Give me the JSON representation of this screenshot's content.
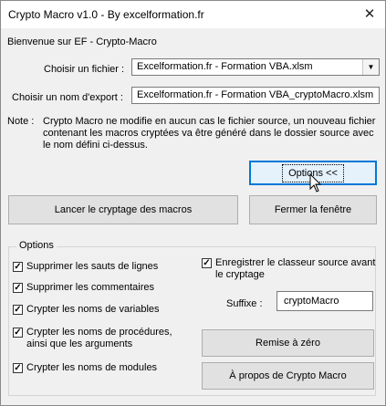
{
  "window": {
    "title": "Crypto Macro v1.0 - By excelformation.fr",
    "close_glyph": "✕"
  },
  "welcome": "Bienvenue sur EF - Crypto-Macro",
  "file": {
    "label": "Choisir un fichier :",
    "value": "Excelformation.fr - Formation VBA.xlsm",
    "arrow": "▼"
  },
  "export": {
    "label": "Choisir un nom d'export :",
    "value": "Excelformation.fr - Formation VBA_cryptoMacro.xlsm"
  },
  "note": {
    "label": "Note :",
    "lines": [
      "Crypto Macro ne modifie en aucun cas le fichier source, un nouveau fichier",
      "contenant les macros cryptées va être généré dans le dossier source avec",
      "le nom défini ci-dessus."
    ]
  },
  "buttons": {
    "options": "Options <<",
    "run": "Lancer le cryptage des macros",
    "close": "Fermer la fenêtre",
    "reset": "Remise à zéro",
    "about": "À propos de Crypto Macro"
  },
  "options": {
    "title": "Options",
    "checks": [
      {
        "label": "Supprimer les sauts de lignes",
        "checked": true
      },
      {
        "label": "Supprimer les commentaires",
        "checked": true
      },
      {
        "label": "Crypter les noms de variables",
        "checked": true
      },
      {
        "label_lines": [
          "Crypter les noms de procédures,",
          "ainsi que les arguments"
        ],
        "checked": true
      },
      {
        "label": "Crypter les noms de modules",
        "checked": true
      }
    ],
    "save_source": {
      "label_lines": [
        "Enregistrer le classeur source avant",
        "le cryptage"
      ],
      "checked": true
    },
    "suffix": {
      "label": "Suffixe :",
      "value": "cryptoMacro"
    },
    "check_glyph": "✓"
  },
  "icons": {
    "cursor": "mouse-pointer-icon"
  }
}
